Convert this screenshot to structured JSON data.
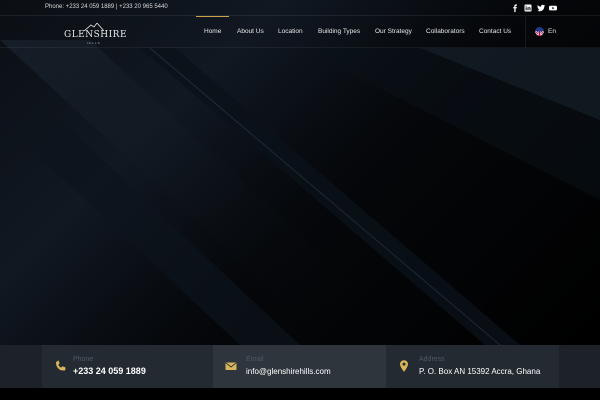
{
  "topbar": {
    "phone_text": "Phone: +233 24 059 1889 | +233 20 965 5440",
    "social": [
      "facebook-icon",
      "linkedin-icon",
      "twitter-icon",
      "youtube-icon"
    ]
  },
  "logo": {
    "name": "GLENSHIRE",
    "sub": "HILLS"
  },
  "nav": {
    "items": [
      "Home",
      "About Us",
      "Location",
      "Building Types",
      "Our Strategy",
      "Collaborators",
      "Contact Us"
    ],
    "active": "Home",
    "language": "En"
  },
  "contacts": [
    {
      "icon": "phone-icon",
      "label": "Phone",
      "value": "+233 24 059 1889"
    },
    {
      "icon": "email-icon",
      "label": "Email",
      "value": "info@glenshirehills.com"
    },
    {
      "icon": "location-pin-icon",
      "label": "Address",
      "value": "P. O. Box AN 15392 Accra, Ghana"
    }
  ],
  "colors": {
    "accent": "#c9a24a",
    "strip_background": "#1c2228",
    "box_dark": "#232a31",
    "box_light": "#2e353d"
  }
}
